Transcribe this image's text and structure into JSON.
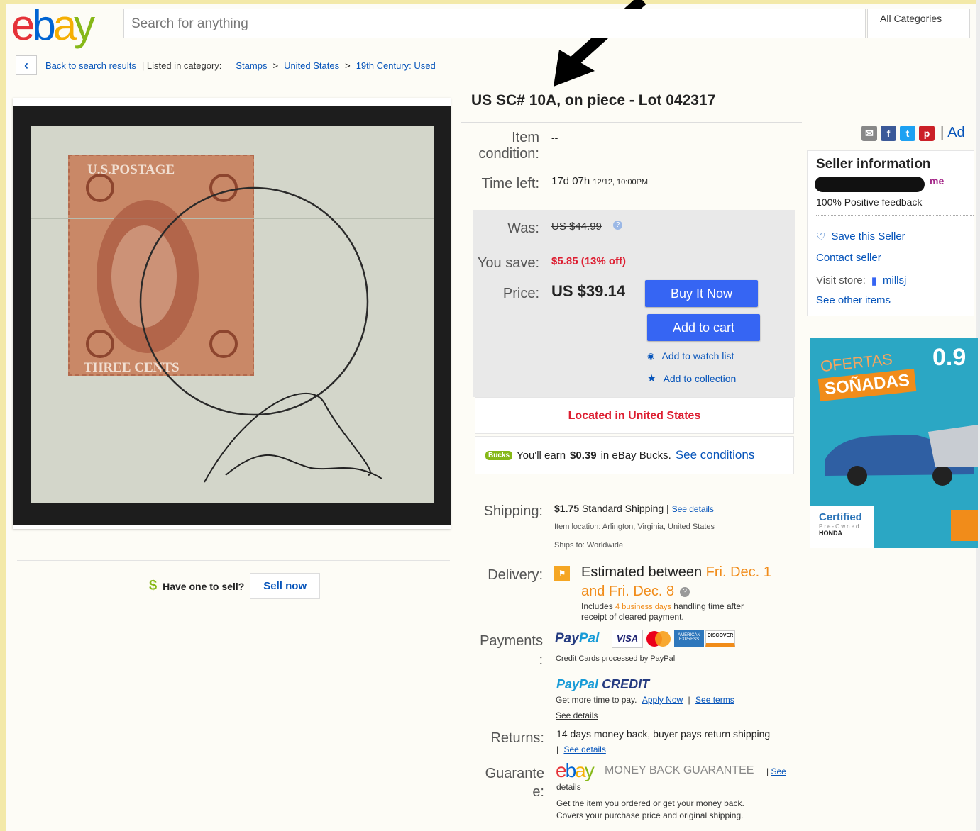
{
  "header": {
    "logo_letters": [
      "e",
      "b",
      "a",
      "y"
    ],
    "search_placeholder": "Search for anything",
    "categories_label": "All Categories"
  },
  "breadcrumb": {
    "back_label": "Back to search results",
    "listed_label": "| Listed in category:",
    "items": [
      "Stamps",
      ">",
      "United States",
      ">",
      "19th Century: Used"
    ]
  },
  "item": {
    "title": "US SC# 10A, on piece - Lot 042317",
    "condition_label_1": "Item",
    "condition_label_2": "condition:",
    "condition_value": "--",
    "time_left_label": "Time left:",
    "time_left_value": "17d 07h",
    "time_left_end": "12/12, 10:00PM",
    "was_label": "Was:",
    "was_value": "US $44.99",
    "save_label": "You save:",
    "save_value": "$5.85 (13% off)",
    "price_label": "Price:",
    "price_value": "US $39.14",
    "buy_now": "Buy It Now",
    "add_to_cart": "Add to cart",
    "watch_list": "Add to watch list",
    "collection": "Add to collection",
    "located": "Located in United States",
    "bucks_badge": "Bucks",
    "bucks_text_1": "You'll earn",
    "bucks_amount": "$0.39",
    "bucks_text_2": "in eBay Bucks.",
    "bucks_link": "See conditions"
  },
  "share": {
    "ad_label": "Ad",
    "separator": "|",
    "fb_glyph": "f",
    "tw_glyph": "t",
    "pin_glyph": "p"
  },
  "seller": {
    "heading": "Seller information",
    "me_badge": "me",
    "feedback": "100% Positive feedback",
    "save_seller": "Save this Seller",
    "contact": "Contact seller",
    "visit_store": "Visit store:",
    "store_name": "millsj",
    "other_items": "See other items"
  },
  "ad": {
    "line1": "OFERTAS",
    "line2": "SOÑADAS",
    "rate": "0.9",
    "certified": "Certified",
    "preowned": "Pre-Owned",
    "brand": "HONDA"
  },
  "sell": {
    "dollar": "$",
    "question": "Have one to sell?",
    "button": "Sell now"
  },
  "shipping": {
    "label": "Shipping:",
    "amount": "$1.75",
    "method": "Standard Shipping |",
    "details": "See details",
    "location": "Item location:  Arlington, Virginia, United States",
    "ships_to": "Ships to:  Worldwide"
  },
  "delivery": {
    "label": "Delivery:",
    "est_prefix": "Estimated between",
    "date1": "Fri. Dec. 1",
    "date2": "and Fri. Dec. 8",
    "includes_1": "Includes",
    "business_days": "4 business days",
    "includes_2": "handling time after",
    "includes_3": "receipt of cleared payment."
  },
  "payments": {
    "label_1": "Payments",
    "label_2": ":",
    "paypal_a": "Pay",
    "paypal_b": "Pal",
    "visa": "VISA",
    "amex": "AMERICAN EXPRESS",
    "discover": "DISCOVER",
    "processed": "Credit Cards processed by PayPal",
    "credit_a": "PayPal",
    "credit_b": "CREDIT",
    "more_time": "Get more time to pay.",
    "apply": "Apply Now",
    "pipe": "|",
    "terms": "See terms",
    "details": "See details"
  },
  "returns": {
    "label": "Returns:",
    "text": "14 days money back, buyer pays return shipping",
    "pipe": "|",
    "details": "See details"
  },
  "guarantee": {
    "label_1": "Guarante",
    "label_2": "e:",
    "mbg": "MONEY BACK GUARANTEE",
    "pipe": "|",
    "see": "See",
    "details": "details",
    "line1": "Get the item you ordered or get your money back.",
    "line2": "Covers your purchase price and original shipping."
  },
  "stamp": {
    "top_text": "U.S.POSTAGE",
    "bottom_text": "THREE CENTS"
  },
  "colors": {
    "accent_blue": "#3665f3",
    "link_blue": "#0654ba",
    "red": "#dd1e31",
    "orange": "#f18c1a"
  }
}
